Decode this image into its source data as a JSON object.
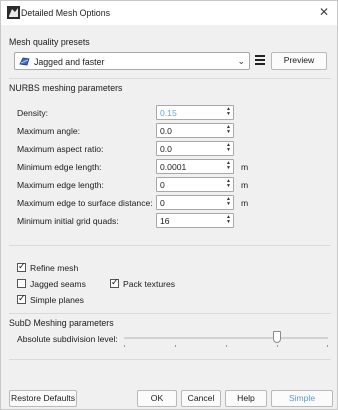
{
  "window": {
    "title": "Detailed Mesh Options",
    "close_glyph": "✕"
  },
  "presets": {
    "section_label": "Mesh quality presets",
    "selected": "Jagged and faster",
    "chevron": "⌄",
    "preview_label": "Preview"
  },
  "nurbs": {
    "section_label": "NURBS meshing parameters",
    "rows": [
      {
        "label": "Density:",
        "value": "0.15",
        "unit": ""
      },
      {
        "label": "Maximum angle:",
        "value": "0.0",
        "unit": ""
      },
      {
        "label": "Maximum aspect ratio:",
        "value": "0.0",
        "unit": ""
      },
      {
        "label": "Minimum edge length:",
        "value": "0.0001",
        "unit": "m"
      },
      {
        "label": "Maximum edge length:",
        "value": "0",
        "unit": "m"
      },
      {
        "label": "Maximum edge to surface distance:",
        "value": "0",
        "unit": "m"
      },
      {
        "label": "Minimum initial grid quads:",
        "value": "16",
        "unit": ""
      }
    ]
  },
  "options": {
    "refine_mesh": {
      "label": "Refine mesh",
      "checked": true
    },
    "jagged_seams": {
      "label": "Jagged seams",
      "checked": false
    },
    "pack_textures": {
      "label": "Pack textures",
      "checked": true
    },
    "simple_planes": {
      "label": "Simple planes",
      "checked": true
    }
  },
  "subd": {
    "section_label": "SubD Meshing parameters",
    "subdivision_label": "Absolute subdivision level:"
  },
  "footer": {
    "restore_label": "Restore Defaults",
    "ok_label": "OK",
    "cancel_label": "Cancel",
    "help_label": "Help",
    "simple_label": "Simple Controls"
  },
  "colors": {
    "accent": "#5a9bd5",
    "muted_value": "#6aa6d6"
  }
}
